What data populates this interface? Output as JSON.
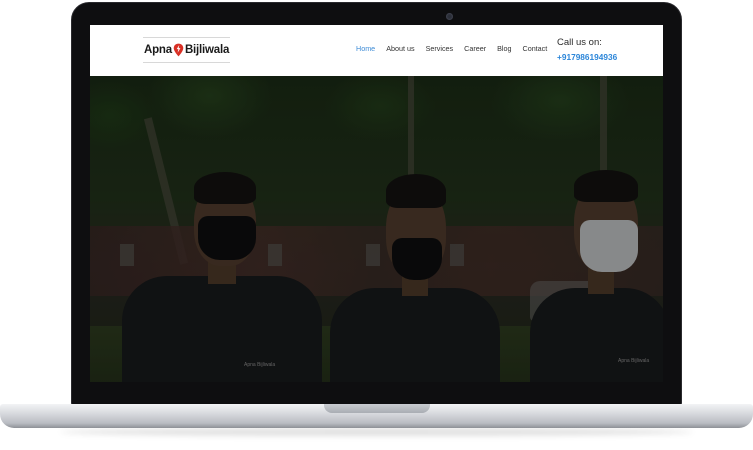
{
  "site": {
    "logo": {
      "part1": "Apna",
      "part2": "Bijliwala",
      "bolt_color": "#d93025"
    },
    "nav": [
      {
        "label": "Home",
        "active": true
      },
      {
        "label": "About us",
        "active": false
      },
      {
        "label": "Services",
        "active": false
      },
      {
        "label": "Career",
        "active": false
      },
      {
        "label": "Blog",
        "active": false
      },
      {
        "label": "Contact",
        "active": false
      }
    ],
    "call": {
      "label": "Call us on:",
      "number": "+917986194936"
    },
    "hero": {
      "shirt_logo_text": "Apna Bijliwala"
    }
  },
  "colors": {
    "nav_active": "#3d8bd6",
    "phone": "#2c86d9",
    "laptop_bezel": "#0e0e10"
  }
}
